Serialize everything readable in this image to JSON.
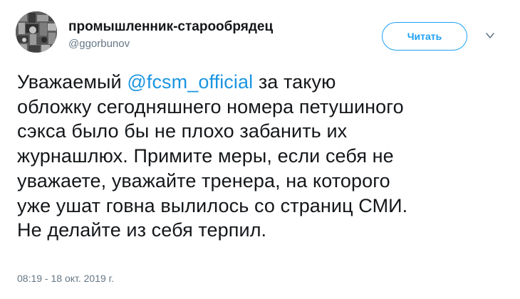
{
  "tweet": {
    "author": {
      "display_name": "промышленник-старообрядец",
      "handle": "@ggorbunov"
    },
    "follow_button": {
      "label": "Читать"
    },
    "text_parts": {
      "before_mention": "Уважаемый ",
      "mention": "@fcsm_official",
      "after_mention": " за такую\nобложку сегодняшнего номера петушиного\nсэкса было бы не плохо забанить их\nжурнашлюх. Примите меры, если себя не\nуважаете, уважайте тренера, на которого\nуже ушат говна вылилось со страниц СМИ.\nНе делайте из себя терпил."
    },
    "timestamp": "08:19 - 18 окт. 2019 г.",
    "icons": {
      "avatar": "avatar-image",
      "menu": "chevron-down-icon"
    },
    "colors": {
      "accent": "#1da1f2",
      "mention": "#1b95e0",
      "secondary_text": "#657786",
      "primary_text": "#14171a"
    }
  }
}
